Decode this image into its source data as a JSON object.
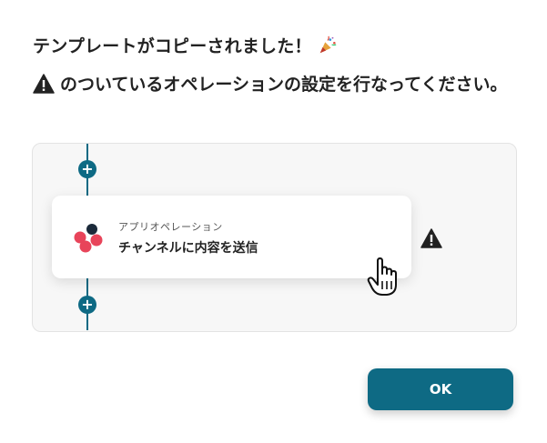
{
  "dialog": {
    "message_line1": "テンプレートがコピーされました！",
    "message_line2": "のついているオペレーションの設定を行なってください。"
  },
  "flow": {
    "card": {
      "subtitle": "アプリオペレーション",
      "title": "チャンネルに内容を送信"
    }
  },
  "buttons": {
    "ok_label": "OK"
  },
  "colors": {
    "accent": "#0e6a84",
    "warning": "#222222"
  },
  "icons": {
    "celebration": "party-popper-icon",
    "warning": "warning-triangle-icon",
    "add": "plus-circle-icon",
    "app": "app-logo-icon",
    "pointer": "hand-pointer-icon"
  }
}
